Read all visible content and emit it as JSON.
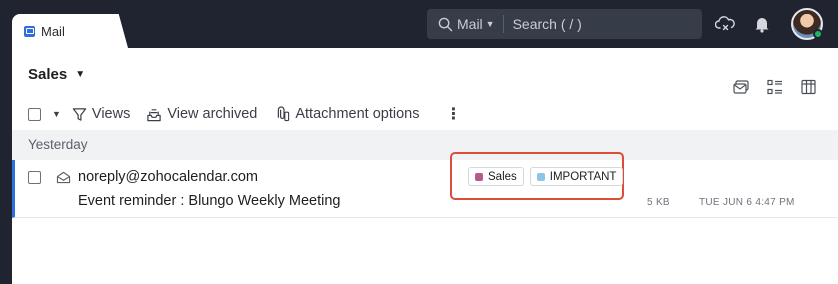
{
  "tab": {
    "label": "Mail",
    "icon": "mail-app-icon"
  },
  "search": {
    "scope": "Mail",
    "placeholder": "Search ( / )"
  },
  "header_icons": [
    "cloud-sync-icon",
    "notification-bell-icon",
    "user-avatar"
  ],
  "folder": {
    "title": "Sales"
  },
  "view_icons": [
    "reading-pane-icon",
    "list-view-icon",
    "column-settings-icon"
  ],
  "toolbar": {
    "views_label": "Views",
    "view_archived_label": "View archived",
    "attachment_options_label": "Attachment options"
  },
  "group": {
    "label": "Yesterday"
  },
  "emails": [
    {
      "sender": "noreply@zohocalendar.com",
      "subject": "Event reminder : Blungo Weekly Meeting",
      "tags": [
        {
          "label": "Sales",
          "color": "#b5598f"
        },
        {
          "label": "IMPORTANT",
          "color": "#8ec3ea"
        }
      ],
      "size": "5 KB",
      "date": "TUE JUN 6 4:47 PM"
    }
  ],
  "colors": {
    "accent": "#2f6fdb",
    "highlight": "#dd4b3a",
    "topbar": "#1f2430",
    "presence": "#26b35f"
  }
}
